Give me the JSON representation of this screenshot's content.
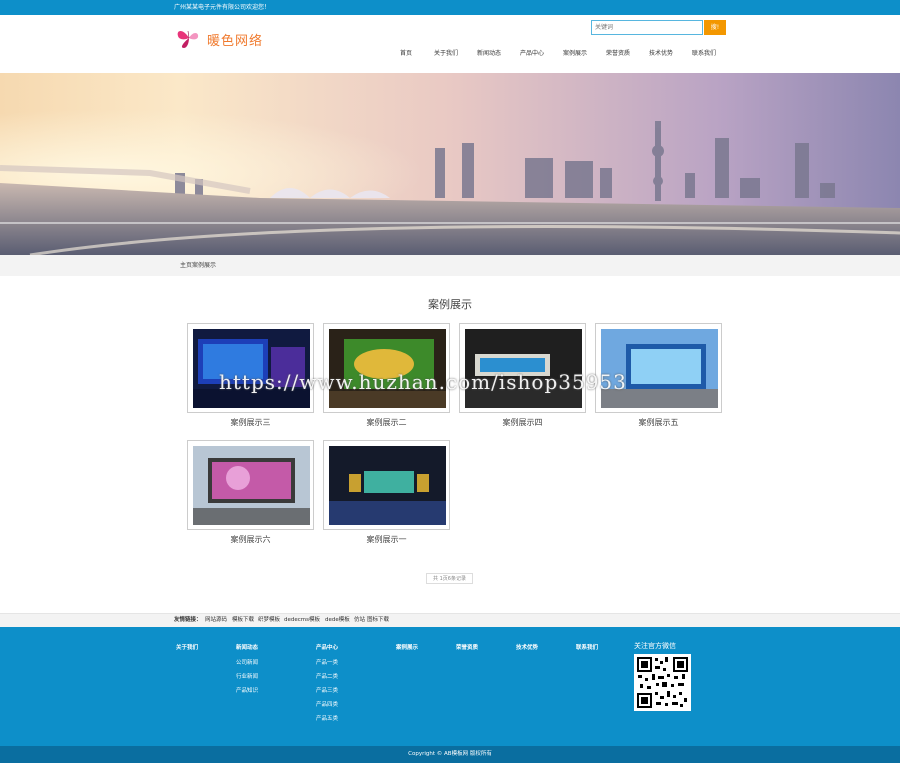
{
  "topbar": {
    "welcome": "广州某某电子元件有限公司欢迎您！"
  },
  "header": {
    "logo_text": "暖色网络",
    "search_placeholder": "关键词",
    "search_button": "搜!"
  },
  "nav": [
    "首页",
    "关于我们",
    "新闻动态",
    "产品中心",
    "案例展示",
    "荣誉资质",
    "技术优势",
    "联系我们"
  ],
  "breadcrumb": "主页案例展示",
  "section_title": "案例展示",
  "cases": [
    {
      "caption": "案例展示三"
    },
    {
      "caption": "案例展示二"
    },
    {
      "caption": "案例展示四"
    },
    {
      "caption": "案例展示五"
    },
    {
      "caption": "案例展示六"
    },
    {
      "caption": "案例展示一"
    }
  ],
  "pager_text": "共 1页6条记录",
  "friend_links": {
    "label": "友情链接：",
    "items": [
      "网站源码",
      "模板下载",
      "织梦模板",
      "dedecms模板",
      "dede模板",
      "仿站",
      "图标下载"
    ]
  },
  "footer": {
    "columns": [
      {
        "title": "关于我们",
        "items": []
      },
      {
        "title": "新闻动态",
        "items": [
          "公司新闻",
          "行业新闻",
          "产品知识"
        ]
      },
      {
        "title": "产品中心",
        "items": [
          "产品一类",
          "产品二类",
          "产品三类",
          "产品四类",
          "产品五类"
        ]
      },
      {
        "title": "案例展示",
        "items": []
      },
      {
        "title": "荣誉资质",
        "items": []
      },
      {
        "title": "技术优势",
        "items": []
      },
      {
        "title": "联系我们",
        "items": []
      }
    ],
    "qr_title": "关注官方微信",
    "copyright": "Copyright © AB模板网 版权所有"
  },
  "watermark": "https://www.huzhan.com/ishop35953",
  "colors": {
    "brand_blue": "#0d8fc9",
    "search_orange": "#f39700"
  }
}
